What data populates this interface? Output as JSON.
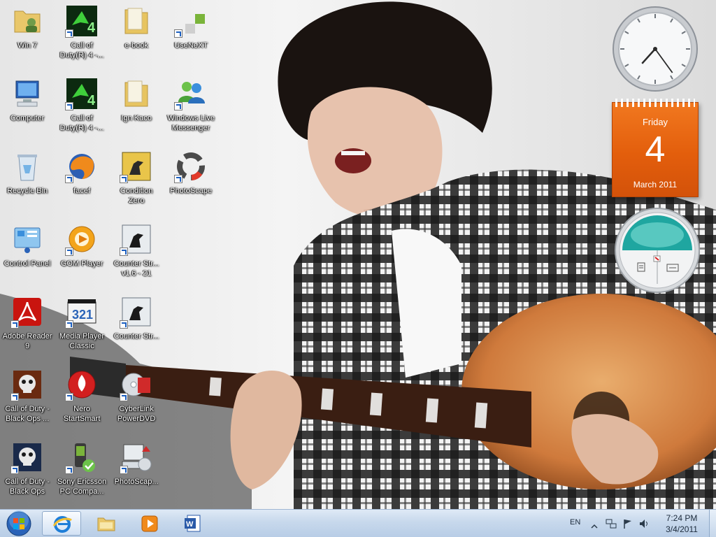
{
  "desktop_icons": [
    {
      "id": "win7",
      "label": "Win 7"
    },
    {
      "id": "cod4a",
      "label": "Call of Duty(R) 4 -..."
    },
    {
      "id": "ebook",
      "label": "e-book"
    },
    {
      "id": "usenext",
      "label": "UseNeXT"
    },
    {
      "id": "computer",
      "label": "Computer"
    },
    {
      "id": "cod4b",
      "label": "Call of Duty(R) 4 -..."
    },
    {
      "id": "ignkaco",
      "label": "Ign Kaco"
    },
    {
      "id": "wlm",
      "label": "Windows Live Messenger"
    },
    {
      "id": "recycle",
      "label": "Recycle Bin"
    },
    {
      "id": "firefox",
      "label": "facef"
    },
    {
      "id": "cszero",
      "label": "Condition Zero"
    },
    {
      "id": "photoscape",
      "label": "PhotoScape"
    },
    {
      "id": "controlpanel",
      "label": "Control Panel"
    },
    {
      "id": "gom",
      "label": "GOM Player"
    },
    {
      "id": "cs16",
      "label": "Counter Str... v1.6 - 21"
    },
    {
      "id": "adobe",
      "label": "Adobe Reader 9"
    },
    {
      "id": "mpc",
      "label": "Media Player Classic"
    },
    {
      "id": "cs2",
      "label": "Counter Str..."
    },
    {
      "id": "bo1",
      "label": "Call of Duty - Black Ops ..."
    },
    {
      "id": "nero",
      "label": "Nero StartSmart"
    },
    {
      "id": "powerdvd",
      "label": "CyberLink PowerDVD"
    },
    {
      "id": "bo2",
      "label": "Call of Duty - Black Ops"
    },
    {
      "id": "sonyericsson",
      "label": "Sony Ericsson PC Compa..."
    },
    {
      "id": "photoscape2",
      "label": "PhotoScap..."
    }
  ],
  "calendar": {
    "day_name": "Friday",
    "date": "4",
    "month_year": "March 2011"
  },
  "clock_gadget": {
    "hour": 7,
    "minute": 24
  },
  "taskbar": {
    "pinned": [
      {
        "id": "ie",
        "name": "Internet Explorer"
      },
      {
        "id": "explorer",
        "name": "Windows Explorer"
      },
      {
        "id": "wmp",
        "name": "Windows Media Player"
      },
      {
        "id": "word",
        "name": "Microsoft Word"
      }
    ],
    "tray": {
      "language": "EN",
      "time": "7:24 PM",
      "date": "3/4/2011"
    }
  },
  "colors": {
    "calendar_orange": "#e35e0c",
    "taskbar": "#c7d8ec",
    "meter_teal": "#1fa6a0"
  }
}
